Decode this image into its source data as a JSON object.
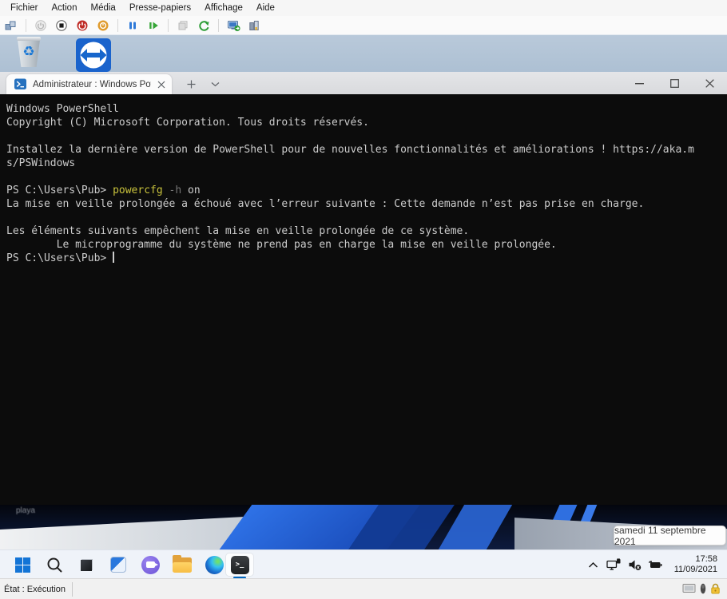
{
  "menu_bar": {
    "items": [
      "Fichier",
      "Action",
      "Média",
      "Presse-papiers",
      "Affichage",
      "Aide"
    ]
  },
  "toolbar": {
    "icons": [
      "ctrl-alt-del",
      "start",
      "stop",
      "shutdown",
      "save",
      "pause",
      "resume",
      "checkpoint",
      "revert",
      "enhanced-session",
      "checkpoint-settings"
    ]
  },
  "desktop": {
    "icons": [
      "recycle-bin",
      "teamviewer"
    ],
    "partial_label": "playa",
    "date_tooltip": "samedi 11 septembre 2021"
  },
  "terminal": {
    "tab_title": "Administrateur : Windows Powe",
    "banner_lines": [
      "Windows PowerShell",
      "Copyright (C) Microsoft Corporation. Tous droits réservés.",
      "",
      "Installez la dernière version de PowerShell pour de nouvelles fonctionnalités et améliorations ! https://aka.m",
      "s/PSWindows",
      ""
    ],
    "prompt": "PS C:\\Users\\Pub> ",
    "command_segments": [
      {
        "text": "powercfg",
        "color": "#c8c23c"
      },
      {
        "text": " -h",
        "color": "#767676"
      },
      {
        "text": " on",
        "color": "#cccccc"
      }
    ],
    "output_lines": [
      "La mise en veille prolongée a échoué avec l’erreur suivante : Cette demande n’est pas prise en charge.",
      "",
      "Les éléments suivants empêchent la mise en veille prolongée de ce système.",
      "        Le microprogramme du système ne prend pas en charge la mise en veille prolongée."
    ],
    "colors": {
      "background": "#0c0c0c",
      "foreground": "#cccccc"
    }
  },
  "taskbar": {
    "icons": [
      "start",
      "search",
      "task-view",
      "widgets",
      "chat",
      "file-explorer",
      "edge",
      "terminal"
    ],
    "active_icon": "terminal",
    "accent_color": "#0067c0"
  },
  "tray": {
    "time": "17:58",
    "date": "11/09/2021",
    "icons": [
      "hidden-icons-chevron",
      "network",
      "volume-muted",
      "battery"
    ]
  },
  "status_bar": {
    "state": "État : Exécution",
    "icons": [
      "display-status",
      "usb-status",
      "lock-status"
    ],
    "lock_color": "#f3c237"
  }
}
